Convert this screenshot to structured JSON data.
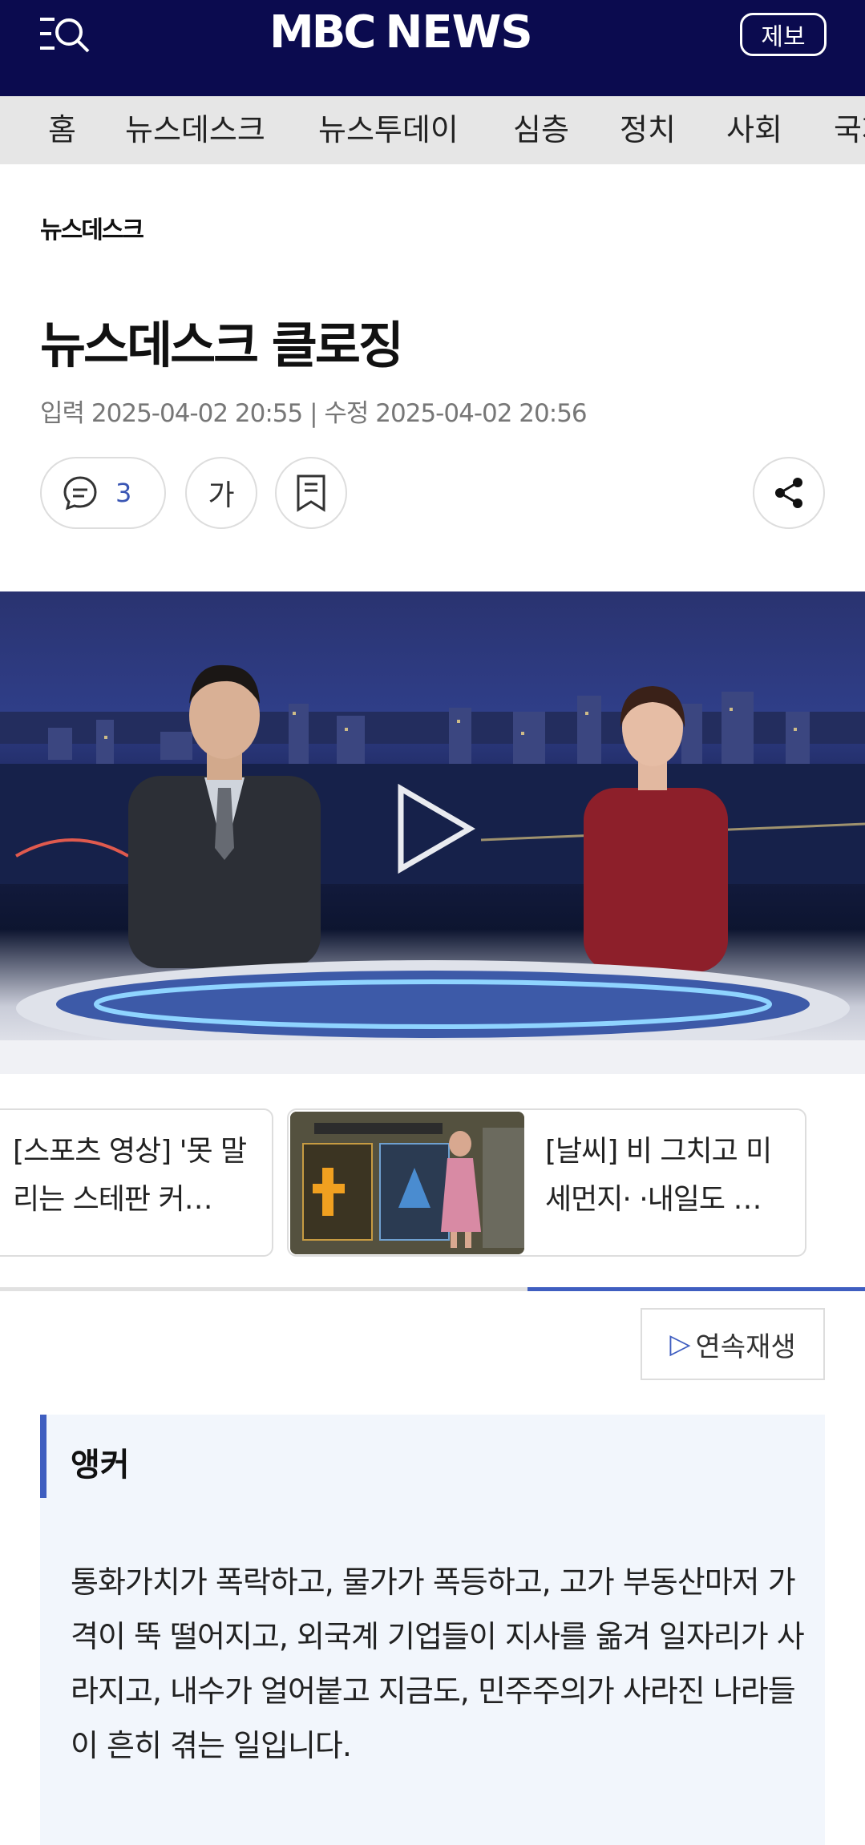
{
  "header": {
    "logo_mbc": "MBC",
    "logo_news": "NEWS",
    "tip_label": "제보"
  },
  "nav": {
    "items": [
      "홈",
      "뉴스데스크",
      "뉴스투데이",
      "심층",
      "정치",
      "사회",
      "국제"
    ]
  },
  "article": {
    "section": "뉴스데스크",
    "title": "뉴스데스크 클로징",
    "dateline": "입력 2025-04-02 20:55 | 수정 2025-04-02 20:56",
    "comment_count": "3",
    "font_size_label": "가"
  },
  "related": [
    {
      "title": "[스포츠 영상] '못 말리는 스테판 커…"
    },
    {
      "title": "[날씨] 비 그치고 미세먼지· ·내일도 …"
    }
  ],
  "autoplay_label": "연속재생",
  "anchor": {
    "label": "앵커",
    "body": "통화가치가 폭락하고, 물가가 폭등하고, 고가 부동산마저 가격이 뚝 떨어지고, 외국계 기업들이 지사를 옮겨 일자리가 사라지고, 내수가 얼어붙고 지금도, 민주주의가 사라진 나라들이 흔히 겪는 일입니다."
  },
  "colors": {
    "header_bg": "#0b0b4f",
    "accent": "#3f5ec0",
    "nav_bg": "#e6e6e6",
    "anchor_bg": "#f2f6fc"
  },
  "icons": [
    "menu-search-icon",
    "comment-icon",
    "bookmark-icon",
    "share-icon",
    "play-icon"
  ]
}
